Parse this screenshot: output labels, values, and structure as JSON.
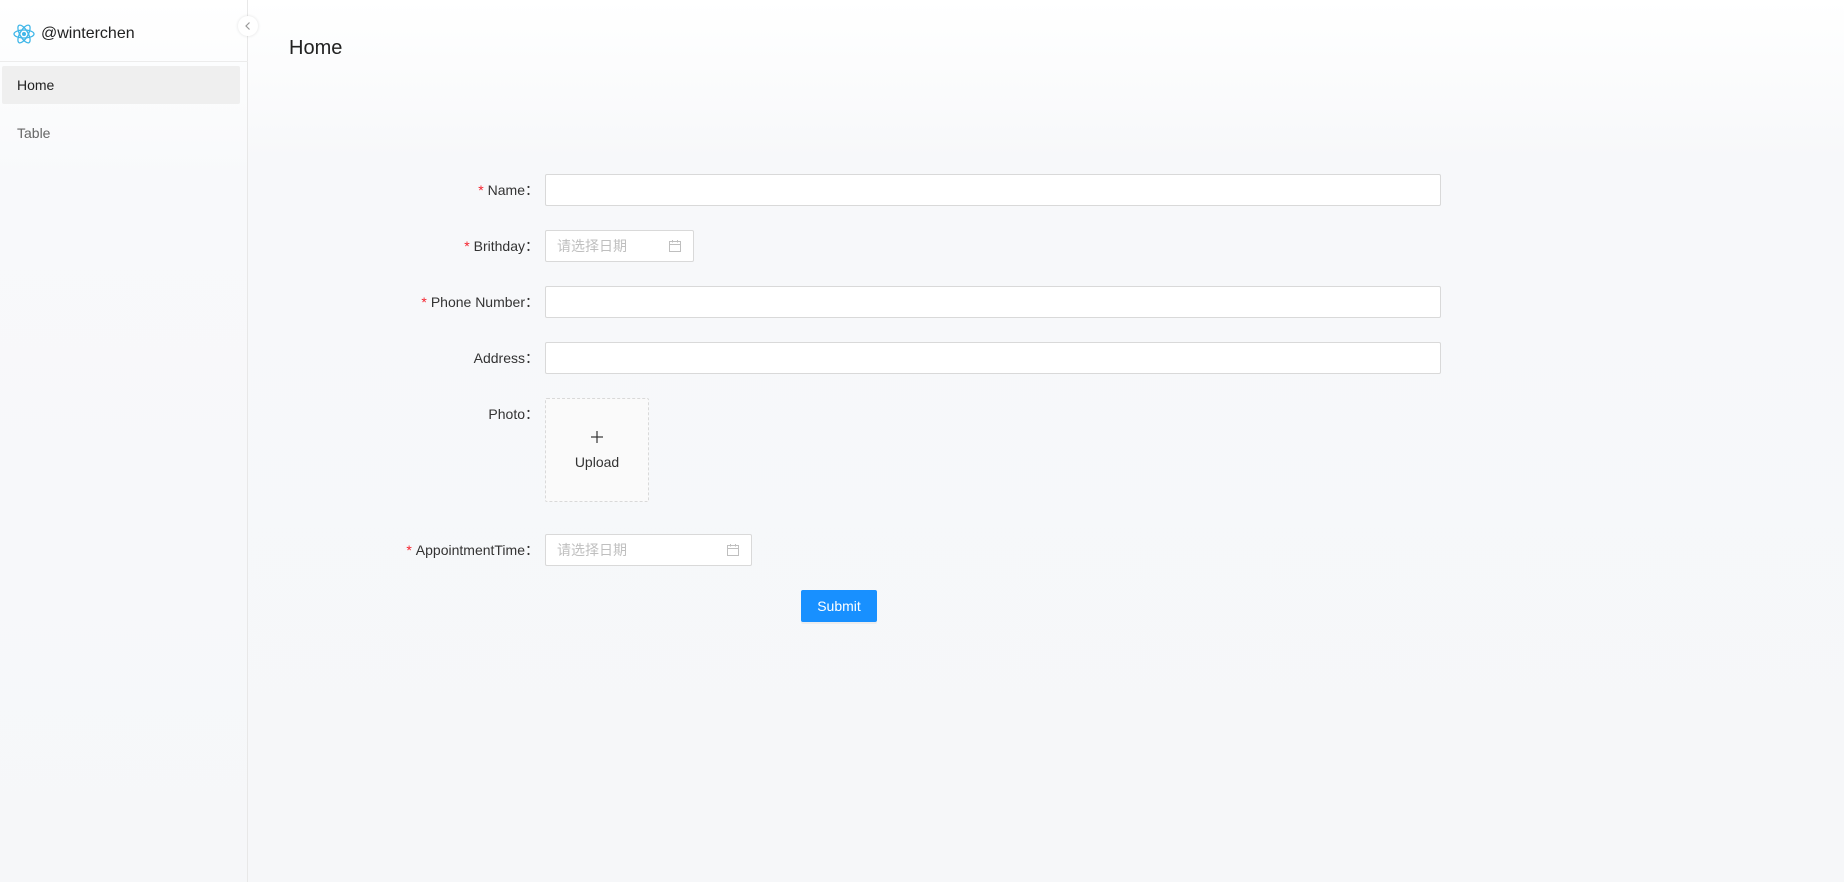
{
  "app": {
    "brand": "@winterchen",
    "logo_icon": "react-atom-icon",
    "accent_color": "#1890ff",
    "required_color": "#f5222d"
  },
  "sidebar": {
    "collapse_icon": "chevron-left-icon",
    "items": [
      {
        "label": "Home",
        "active": true
      },
      {
        "label": "Table",
        "active": false
      }
    ]
  },
  "page": {
    "title": "Home"
  },
  "form": {
    "name": {
      "label": "Name",
      "required": true,
      "value": ""
    },
    "birthday": {
      "label": "Brithday",
      "required": true,
      "placeholder": "请选择日期",
      "icon": "calendar-icon"
    },
    "phone": {
      "label": "Phone Number",
      "required": true,
      "value": ""
    },
    "address": {
      "label": "Address",
      "required": false,
      "value": ""
    },
    "photo": {
      "label": "Photo",
      "required": false,
      "upload_label": "Upload",
      "icon": "plus-icon"
    },
    "appointment": {
      "label": "AppointmentTime",
      "required": true,
      "placeholder": "请选择日期",
      "icon": "calendar-icon"
    },
    "submit_label": "Submit",
    "label_separator": "："
  }
}
